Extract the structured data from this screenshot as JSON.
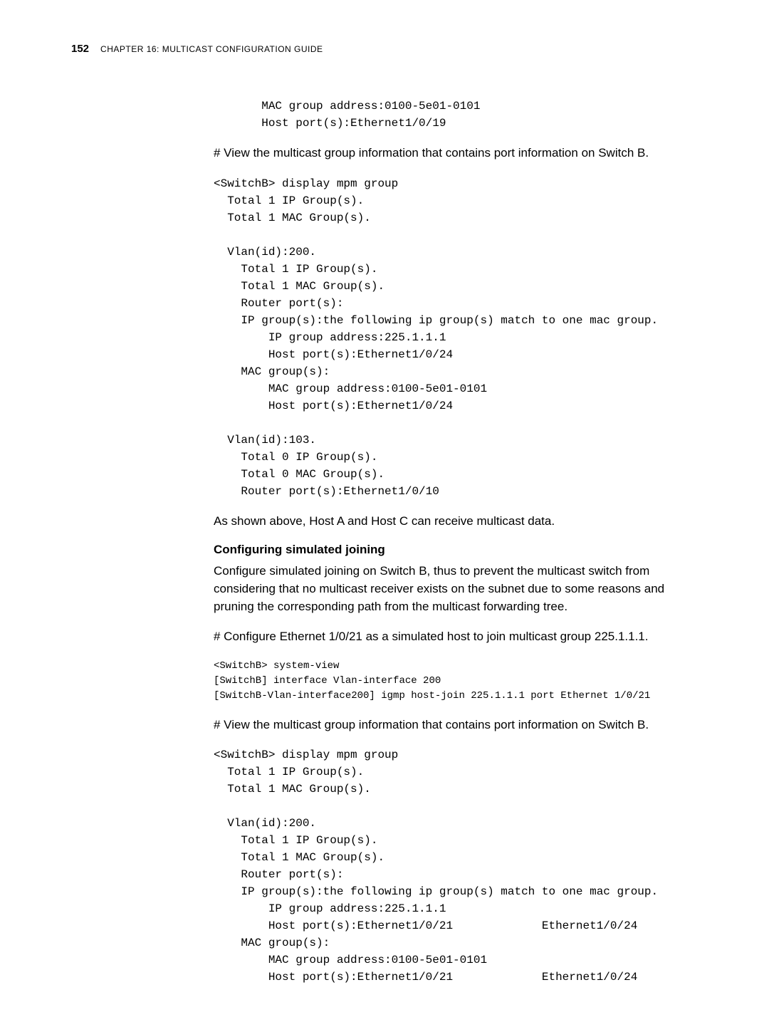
{
  "header": {
    "page_number": "152",
    "chapter_label": "CHAPTER 16: MULTICAST CONFIGURATION GUIDE"
  },
  "blocks": {
    "code1": "       MAC group address:0100-5e01-0101\n       Host port(s):Ethernet1/0/19",
    "para1": "# View the multicast group information that contains port information on Switch B.",
    "code2": "<SwitchB> display mpm group\n  Total 1 IP Group(s).\n  Total 1 MAC Group(s).\n\n  Vlan(id):200.\n    Total 1 IP Group(s).\n    Total 1 MAC Group(s).\n    Router port(s):\n    IP group(s):the following ip group(s) match to one mac group.\n        IP group address:225.1.1.1\n        Host port(s):Ethernet1/0/24\n    MAC group(s):\n        MAC group address:0100-5e01-0101\n        Host port(s):Ethernet1/0/24\n\n  Vlan(id):103.\n    Total 0 IP Group(s).\n    Total 0 MAC Group(s).\n    Router port(s):Ethernet1/0/10",
    "para2": "As shown above, Host A and Host C can receive multicast data.",
    "heading1": "Configuring simulated joining",
    "para3": "Configure simulated joining on Switch B, thus to prevent the multicast switch from considering that no multicast receiver exists on the subnet due to some reasons and pruning the corresponding path from the multicast forwarding tree.",
    "para4": "# Configure Ethernet 1/0/21 as a simulated host to join multicast group 225.1.1.1.",
    "code3": "<SwitchB> system-view\n[SwitchB] interface Vlan-interface 200\n[SwitchB-Vlan-interface200] igmp host-join 225.1.1.1 port Ethernet 1/0/21",
    "para5": "# View the multicast group information that contains port information on Switch B.",
    "code4": "<SwitchB> display mpm group\n  Total 1 IP Group(s).\n  Total 1 MAC Group(s).\n\n  Vlan(id):200.\n    Total 1 IP Group(s).\n    Total 1 MAC Group(s).\n    Router port(s):\n    IP group(s):the following ip group(s) match to one mac group.\n        IP group address:225.1.1.1\n        Host port(s):Ethernet1/0/21             Ethernet1/0/24\n    MAC group(s):\n        MAC group address:0100-5e01-0101\n        Host port(s):Ethernet1/0/21             Ethernet1/0/24"
  }
}
